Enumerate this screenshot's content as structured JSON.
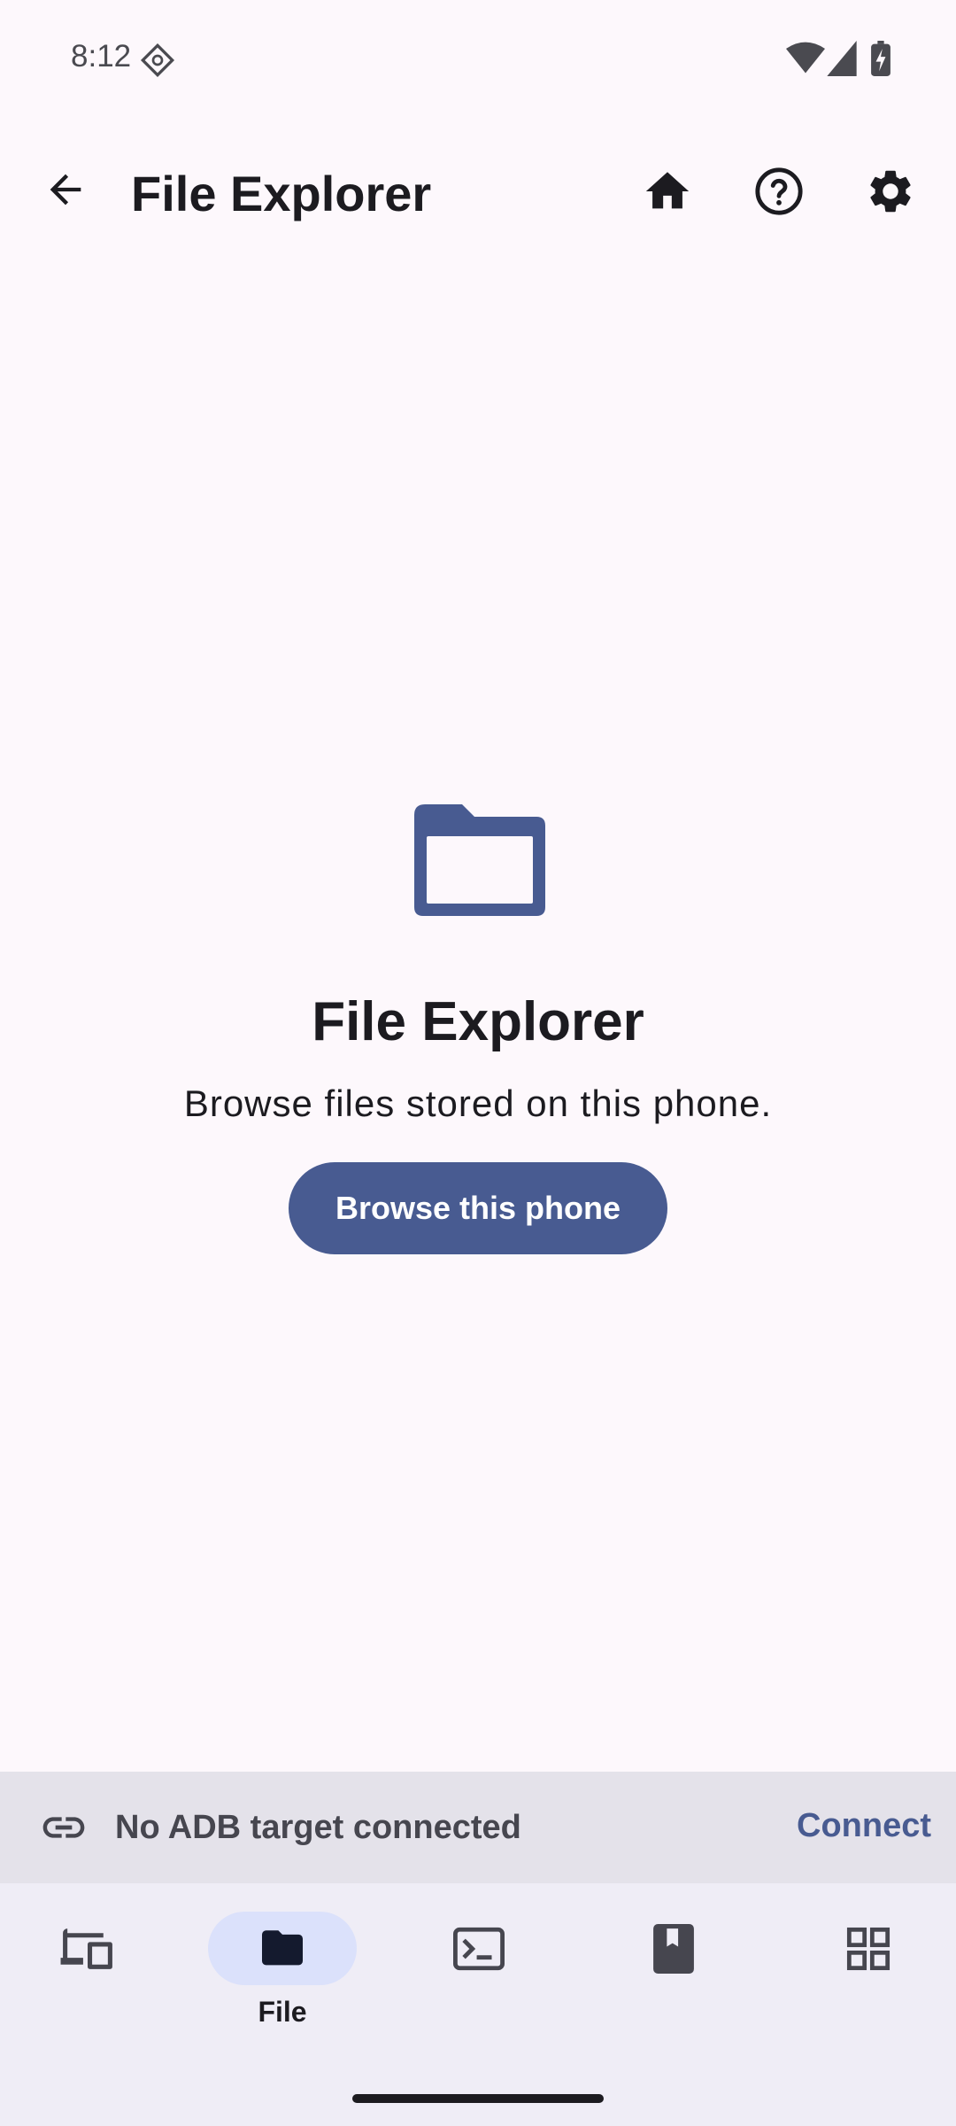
{
  "status_bar": {
    "time": "8:12",
    "icons": [
      "data-saver-icon",
      "wifi-icon",
      "signal-icon",
      "battery-icon"
    ]
  },
  "app_bar": {
    "title": "File Explorer",
    "back_icon": "arrow-back-icon",
    "actions": [
      "home-icon",
      "help-icon",
      "settings-icon"
    ]
  },
  "empty_state": {
    "icon": "folder-icon",
    "title": "File Explorer",
    "subtitle": "Browse files stored on this phone.",
    "button_label": "Browse this phone"
  },
  "banner": {
    "icon": "link-icon",
    "text": "No ADB target connected",
    "action_label": "Connect"
  },
  "bottom_nav": {
    "items": [
      {
        "icon": "devices-icon",
        "label": ""
      },
      {
        "icon": "folder-icon",
        "label": "File",
        "active": true
      },
      {
        "icon": "terminal-icon",
        "label": ""
      },
      {
        "icon": "book-icon",
        "label": ""
      },
      {
        "icon": "apps-grid-icon",
        "label": ""
      }
    ]
  },
  "colors": {
    "background": "#fdf8fc",
    "accent": "#485b91",
    "banner": "#e4e2ea",
    "nav": "#efedf6",
    "nav_active_pill": "#dbe1fb"
  }
}
